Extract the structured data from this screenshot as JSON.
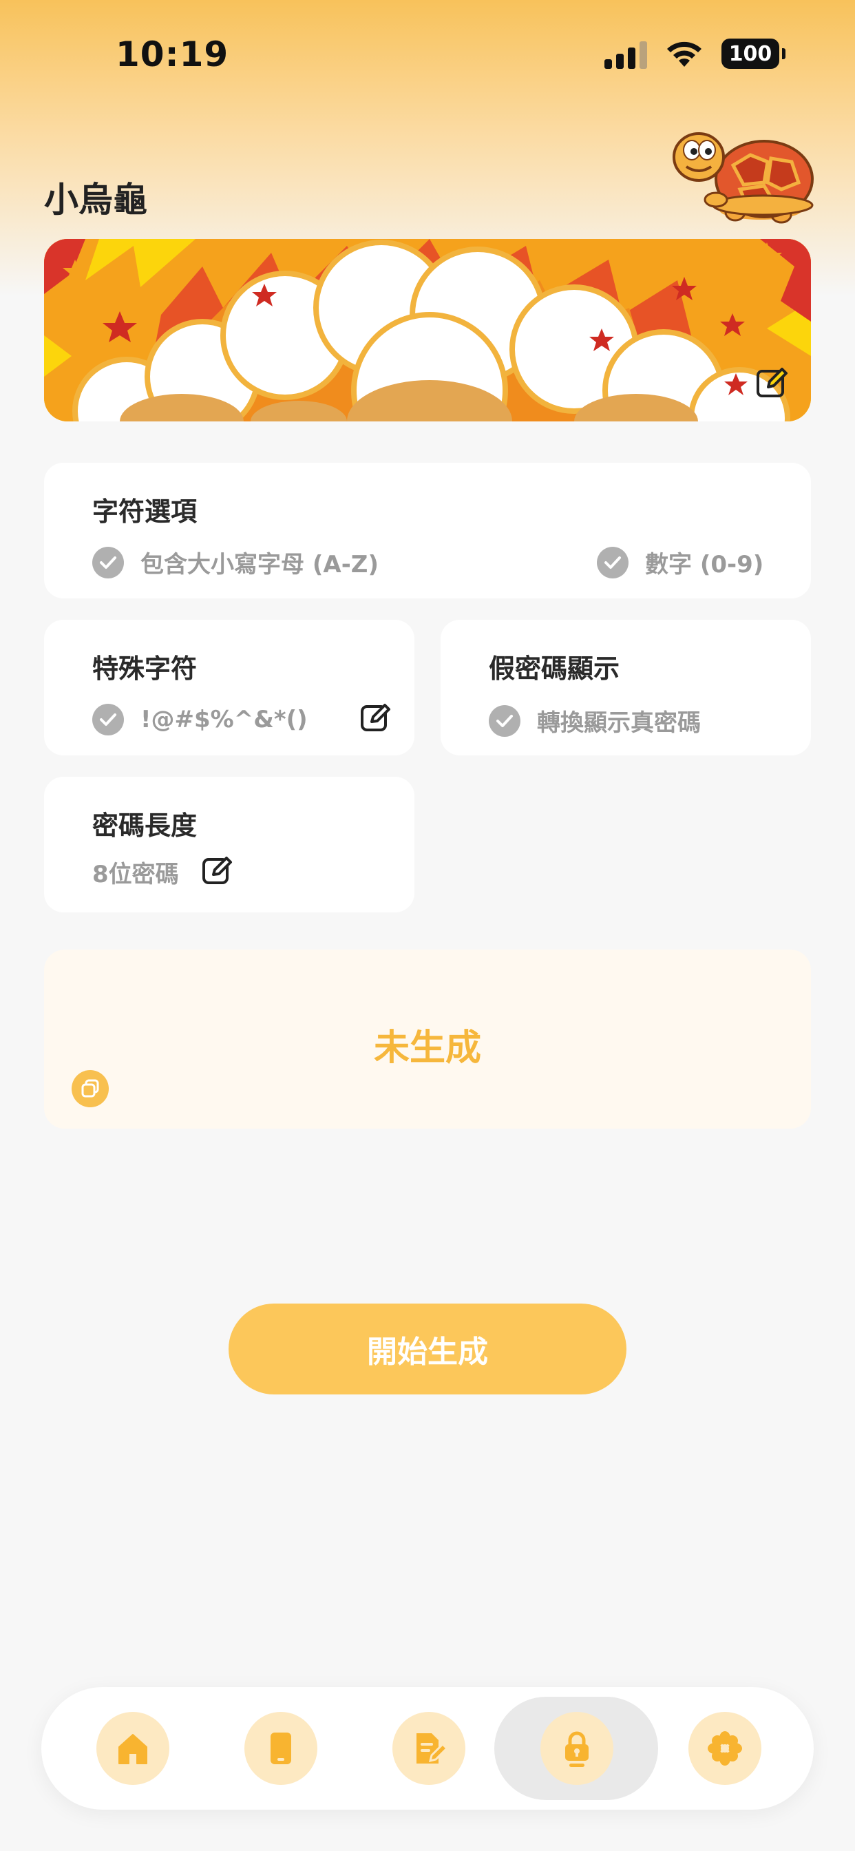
{
  "status_bar": {
    "time": "10:19",
    "battery": "100"
  },
  "header": {
    "title": "小烏龜"
  },
  "character_options": {
    "title": "字符選項",
    "option_letters": "包含大小寫字母 (A-Z)",
    "option_digits": "數字 (0-9)"
  },
  "special_chars": {
    "title": "特殊字符",
    "value": "!@#$%^&*()"
  },
  "fake_password": {
    "title": "假密碼顯示",
    "value": "轉換顯示真密碼"
  },
  "password_length": {
    "title": "密碼長度",
    "value": "8位密碼"
  },
  "result": {
    "text": "未生成"
  },
  "generate_button": {
    "label": "開始生成"
  },
  "tabbar": {
    "items": [
      {
        "icon": "home-icon",
        "active": false
      },
      {
        "icon": "tablet-icon",
        "active": false
      },
      {
        "icon": "document-edit-icon",
        "active": false
      },
      {
        "icon": "lock-icon",
        "active": true
      },
      {
        "icon": "flower-settings-icon",
        "active": false
      }
    ]
  },
  "colors": {
    "accent": "#fcc75a",
    "accent_text": "#f6b73c",
    "tab_icon": "#f8b430",
    "tab_bg": "#fde9c2"
  }
}
